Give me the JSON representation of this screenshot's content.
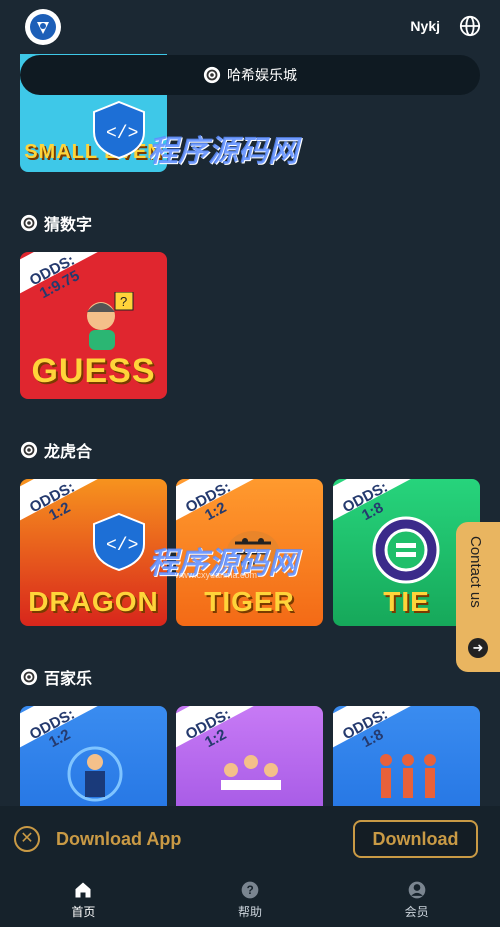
{
  "header": {
    "user": "Nykj",
    "globe_icon": "globe-icon",
    "logo_icon": "shield-logo-icon"
  },
  "banner": {
    "title": "哈希娱乐城",
    "icon": "chip-icon"
  },
  "sections": [
    {
      "title": "猜数字",
      "cards": [
        {
          "odds_label": "ODDS:",
          "odds": "1:9.75",
          "label": "GUESS",
          "color": "#e0262f"
        }
      ]
    },
    {
      "title": "龙虎合",
      "cards": [
        {
          "odds_label": "ODDS:",
          "odds": "1:2",
          "label": "DRAGON",
          "color": "#f36a16"
        },
        {
          "odds_label": "ODDS:",
          "odds": "1:2",
          "label": "TIGER",
          "color": "#f7831e"
        },
        {
          "odds_label": "ODDS:",
          "odds": "1:8",
          "label": "TIE",
          "color": "#1fbf6a"
        }
      ]
    },
    {
      "title": "百家乐",
      "cards": [
        {
          "odds_label": "ODDS:",
          "odds": "1:2",
          "label": "",
          "color": "#1f6fe0"
        },
        {
          "odds_label": "ODDS:",
          "odds": "1:2",
          "label": "",
          "color": "#b25ff0"
        },
        {
          "odds_label": "ODDS:",
          "odds": "1:8",
          "label": "",
          "color": "#1f6fe0"
        }
      ]
    }
  ],
  "top_card": {
    "label": "SMALL EVEN"
  },
  "watermark": {
    "text": "程序源码网",
    "url": "www.cxyuanma.com"
  },
  "contact": {
    "label": "Contact us"
  },
  "download_bar": {
    "text": "Download App",
    "button": "Download"
  },
  "nav": [
    {
      "label": "首页",
      "icon": "home-icon"
    },
    {
      "label": "帮助",
      "icon": "help-icon"
    },
    {
      "label": "会员",
      "icon": "member-icon"
    }
  ],
  "colors": {
    "background": "#1b2833",
    "gold": "#c99a45",
    "contact": "#e9b560"
  }
}
